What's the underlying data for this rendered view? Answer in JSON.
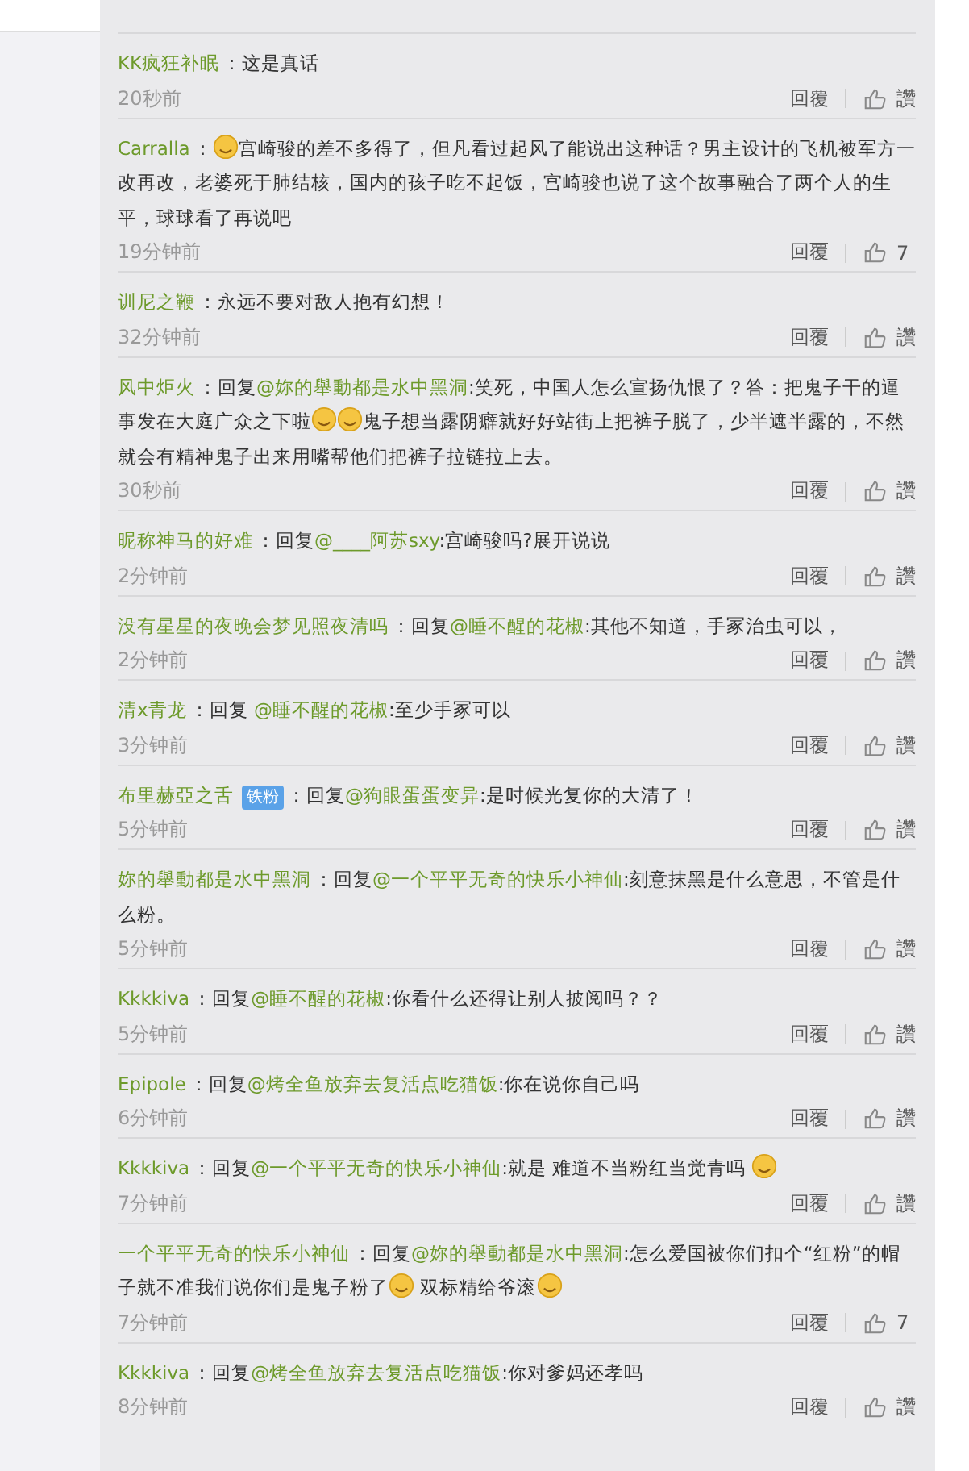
{
  "comments": [
    {
      "user": "KK疯狂补眠",
      "body": [
        {
          "kind": "text",
          "text": "：这是真话"
        }
      ],
      "time": "20秒前",
      "reply": "回覆",
      "like": "讚"
    },
    {
      "user": "Carralla",
      "body": [
        {
          "kind": "text",
          "text": "："
        },
        {
          "kind": "emoji"
        },
        {
          "kind": "text",
          "text": "宫崎骏的差不多得了，但凡看过起风了能说出这种话？男主设计的飞机被军方一改再改，老婆死于肺结核，国内的孩子吃不起饭，宫崎骏也说了这个故事融合了两个人的生平，球球看了再说吧"
        }
      ],
      "time": "19分钟前",
      "reply": "回覆",
      "like": "7"
    },
    {
      "user": "训尼之鞭",
      "body": [
        {
          "kind": "text",
          "text": "：永远不要对敌人抱有幻想！"
        }
      ],
      "time": "32分钟前",
      "reply": "回覆",
      "like": "讚"
    },
    {
      "user": "风中炬火",
      "body": [
        {
          "kind": "text",
          "text": "：回复"
        },
        {
          "kind": "mention",
          "text": "@妳的舉動都是水中黑洞"
        },
        {
          "kind": "text",
          "text": ":笑死，中国人怎么宣扬仇恨了？答：把鬼子干的逼事发在大庭广众之下啦"
        },
        {
          "kind": "emoji"
        },
        {
          "kind": "emoji"
        },
        {
          "kind": "text",
          "text": "鬼子想当露阴癖就好好站街上把裤子脱了，少半遮半露的，不然就会有精神鬼子出来用嘴帮他们把裤子拉链拉上去。"
        }
      ],
      "time": "30秒前",
      "reply": "回覆",
      "like": "讚"
    },
    {
      "user": "昵称神马的好难",
      "body": [
        {
          "kind": "text",
          "text": "：回复"
        },
        {
          "kind": "mention",
          "text": "@____阿苏sxy"
        },
        {
          "kind": "text",
          "text": ":宫崎骏吗?展开说说"
        }
      ],
      "time": "2分钟前",
      "reply": "回覆",
      "like": "讚"
    },
    {
      "user": "没有星星的夜晚会梦见照夜清吗",
      "body": [
        {
          "kind": "text",
          "text": "：回复"
        },
        {
          "kind": "mention",
          "text": "@睡不醒的花椒"
        },
        {
          "kind": "text",
          "text": ":其他不知道，手冢治虫可以，"
        }
      ],
      "time": "2分钟前",
      "reply": "回覆",
      "like": "讚"
    },
    {
      "user": "清x青龙",
      "body": [
        {
          "kind": "text",
          "text": "：回复 "
        },
        {
          "kind": "mention",
          "text": "@睡不醒的花椒"
        },
        {
          "kind": "text",
          "text": ":至少手冢可以"
        }
      ],
      "time": "3分钟前",
      "reply": "回覆",
      "like": "讚"
    },
    {
      "user": "布里赫亞之舌",
      "badge": "铁粉",
      "body": [
        {
          "kind": "text",
          "text": "：回复"
        },
        {
          "kind": "mention",
          "text": "@狗眼蛋蛋变异"
        },
        {
          "kind": "text",
          "text": ":是时候光复你的大清了！"
        }
      ],
      "time": "5分钟前",
      "reply": "回覆",
      "like": "讚"
    },
    {
      "user": "妳的舉動都是水中黑洞",
      "body": [
        {
          "kind": "text",
          "text": "：回复"
        },
        {
          "kind": "mention",
          "text": "@一个平平无奇的快乐小神仙"
        },
        {
          "kind": "text",
          "text": ":刻意抹黑是什么意思，不管是什么粉。"
        }
      ],
      "time": "5分钟前",
      "reply": "回覆",
      "like": "讚"
    },
    {
      "user": "Kkkkiva",
      "body": [
        {
          "kind": "text",
          "text": "：回复"
        },
        {
          "kind": "mention",
          "text": "@睡不醒的花椒"
        },
        {
          "kind": "text",
          "text": ":你看什么还得让别人披阅吗？？"
        }
      ],
      "time": "5分钟前",
      "reply": "回覆",
      "like": "讚"
    },
    {
      "user": "Epipole",
      "body": [
        {
          "kind": "text",
          "text": "：回复"
        },
        {
          "kind": "mention",
          "text": "@烤全鱼放弃去复活点吃猫饭"
        },
        {
          "kind": "text",
          "text": ":你在说你自己吗"
        }
      ],
      "time": "6分钟前",
      "reply": "回覆",
      "like": "讚"
    },
    {
      "user": "Kkkkiva",
      "body": [
        {
          "kind": "text",
          "text": "：回复"
        },
        {
          "kind": "mention",
          "text": "@一个平平无奇的快乐小神仙"
        },
        {
          "kind": "text",
          "text": ":就是  难道不当粉红当觉青吗 "
        },
        {
          "kind": "emoji"
        }
      ],
      "time": "7分钟前",
      "reply": "回覆",
      "like": "讚"
    },
    {
      "user": "一个平平无奇的快乐小神仙",
      "body": [
        {
          "kind": "text",
          "text": "：回复"
        },
        {
          "kind": "mention",
          "text": "@妳的舉動都是水中黑洞"
        },
        {
          "kind": "text",
          "text": ":怎么爱国被你们扣个“红粉”的帽子就不准我们说你们是鬼子粉了"
        },
        {
          "kind": "emoji"
        },
        {
          "kind": "text",
          "text": " 双标精给爷滚"
        },
        {
          "kind": "emoji"
        }
      ],
      "time": "7分钟前",
      "reply": "回覆",
      "like": "7"
    },
    {
      "user": "Kkkkiva",
      "body": [
        {
          "kind": "text",
          "text": "：回复"
        },
        {
          "kind": "mention",
          "text": "@烤全鱼放弃去复活点吃猫饭"
        },
        {
          "kind": "text",
          "text": ":你对爹妈还孝吗"
        }
      ],
      "time": "8分钟前",
      "reply": "回覆",
      "like": "讚"
    }
  ]
}
